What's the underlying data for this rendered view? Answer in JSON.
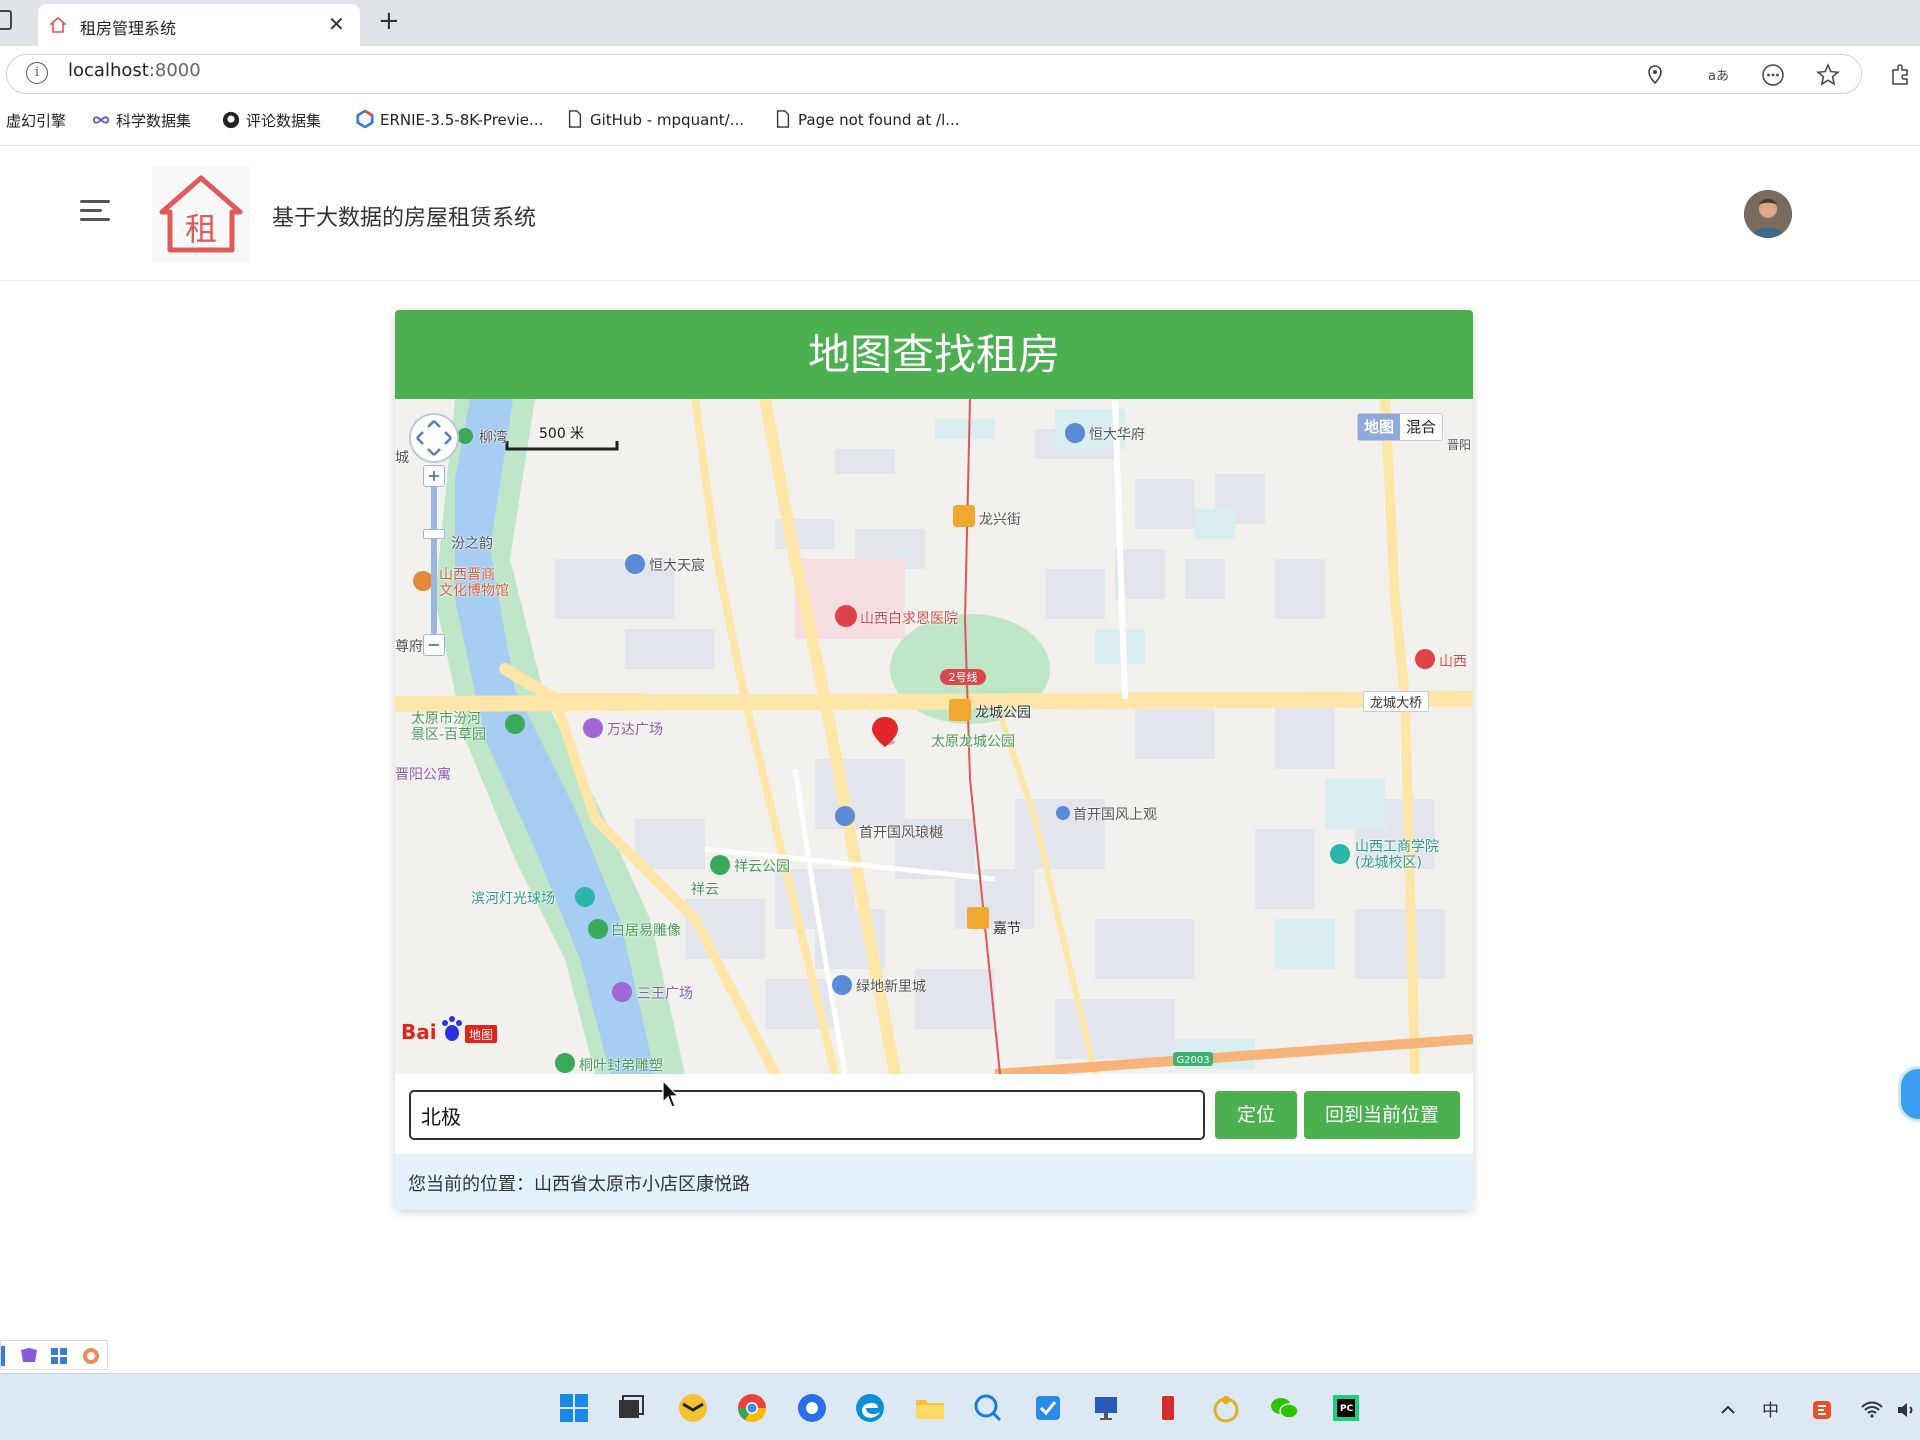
{
  "browser": {
    "tab_title": "租房管理系统",
    "tab_close": "✕",
    "new_tab": "+",
    "url_host": "localhost",
    "url_port": ":8000",
    "address_icons": [
      "location-icon",
      "read-aloud-icon",
      "more-icon",
      "favorites-star-icon",
      "extensions-icon"
    ],
    "bookmarks": [
      {
        "label": "虚幻引擎",
        "icon": "none"
      },
      {
        "label": "科学数据集",
        "icon": "infinity-icon"
      },
      {
        "label": "评论数据集",
        "icon": "github-icon"
      },
      {
        "label": "ERNIE-3.5-8K-Previe...",
        "icon": "ernie-icon"
      },
      {
        "label": "GitHub - mpquant/...",
        "icon": "page-icon"
      },
      {
        "label": "Page not found at /l...",
        "icon": "page-icon"
      }
    ]
  },
  "app": {
    "title": "基于大数据的房屋租赁系统",
    "logo_char": "租"
  },
  "card": {
    "header": "地图查找租房",
    "search_value": "北极",
    "locate_label": "定位",
    "back_label": "回到当前位置",
    "location_text": "您当前的位置：山西省太原市小店区康悦路"
  },
  "map": {
    "scale_label": "500 米",
    "type_map": "地图",
    "type_hybrid": "混合",
    "zoom_in": "+",
    "zoom_out": "−",
    "baidu_logo": "Bai地图",
    "labels": {
      "liuxiang": "柳湾",
      "hengda_huafu": "恒大华府",
      "longxing_street": "龙兴街",
      "fenzhiyun": "汾之韵",
      "jinshang_museum": "山西晋商\n文化博物馆",
      "hengda_tianchen": "恒大天宸",
      "baiqiuen_hospital": "山西白求恩医院",
      "shanxi_right": "山西",
      "line2": "2号线",
      "longcheng_bridge": "龙城大桥",
      "longcheng_park_station": "龙城公园",
      "longcheng_park": "太原龙城公园",
      "fenhe_park": "太原市汾河\n景区-百草园",
      "wanda": "万达广场",
      "jinyang_apt": "晋阳公寓",
      "shoukai_shangguan": "首开国风上观",
      "shoukai_langshu": "首开国风琅樾",
      "gongshang_college": "山西工商学院\n(龙城校区)",
      "xiangyun_park": "祥云公园",
      "xiangyun": "祥云",
      "binhe_light": "滨河灯光球场",
      "baijuyi": "白居易雕像",
      "jiajie": "嘉节",
      "sanwang": "三王广场",
      "lvdi": "绿地新里城",
      "tongye": "桐叶封弟雕塑",
      "g2003": "G2003",
      "zunfu": "尊府",
      "cheng": "城",
      "shiyang": "晋阳"
    }
  },
  "taskbar": {
    "tray_ime": "中",
    "floating_tools": [
      "tool-a-icon",
      "tool-b-icon",
      "tool-c-icon",
      "tool-d-icon"
    ]
  }
}
